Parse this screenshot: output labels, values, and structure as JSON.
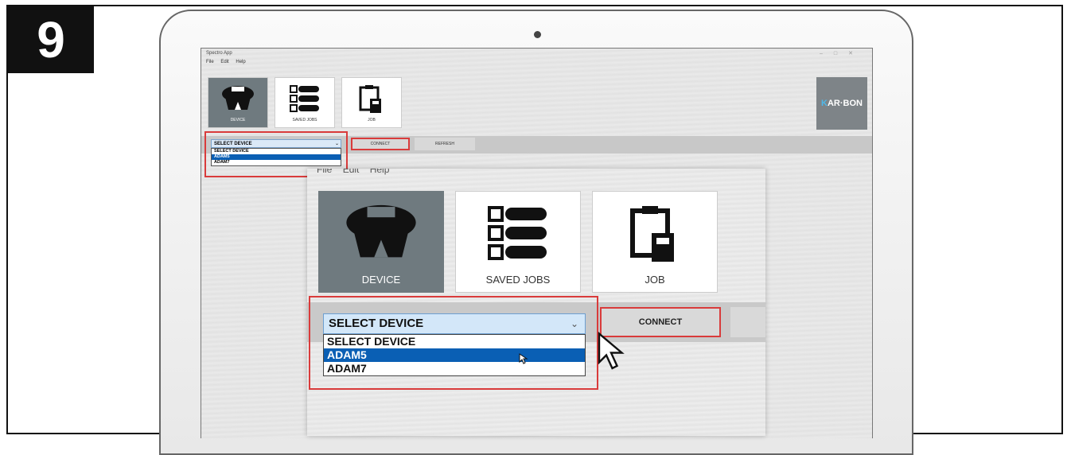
{
  "step": {
    "number": "9"
  },
  "app": {
    "title": "Spectro App",
    "window_controls": [
      "–",
      "□",
      "✕"
    ],
    "menu": [
      "File",
      "Edit",
      "Help"
    ],
    "toolbar": [
      {
        "label": "DEVICE",
        "icon": "device-icon",
        "active": true
      },
      {
        "label": "SAVED JOBS",
        "icon": "saved-jobs-icon",
        "active": false
      },
      {
        "label": "JOB",
        "icon": "job-icon",
        "active": false
      }
    ],
    "logo": {
      "prefix": "K",
      "rest": "AR·BON"
    },
    "device_select": {
      "value": "SELECT DEVICE",
      "options": [
        "SELECT DEVICE",
        "ADAM5",
        "ADAM7"
      ],
      "highlighted": "ADAM5"
    },
    "connect_label": "CONNECT",
    "refresh_label": "REFRESH"
  },
  "zoom": {
    "menu": [
      "File",
      "Edit",
      "Help"
    ]
  },
  "colors": {
    "highlight": "#d93b3b",
    "selected": "#0a5fb4",
    "active_tile": "#6f7a7f",
    "logo_accent": "#4fb8e8"
  }
}
